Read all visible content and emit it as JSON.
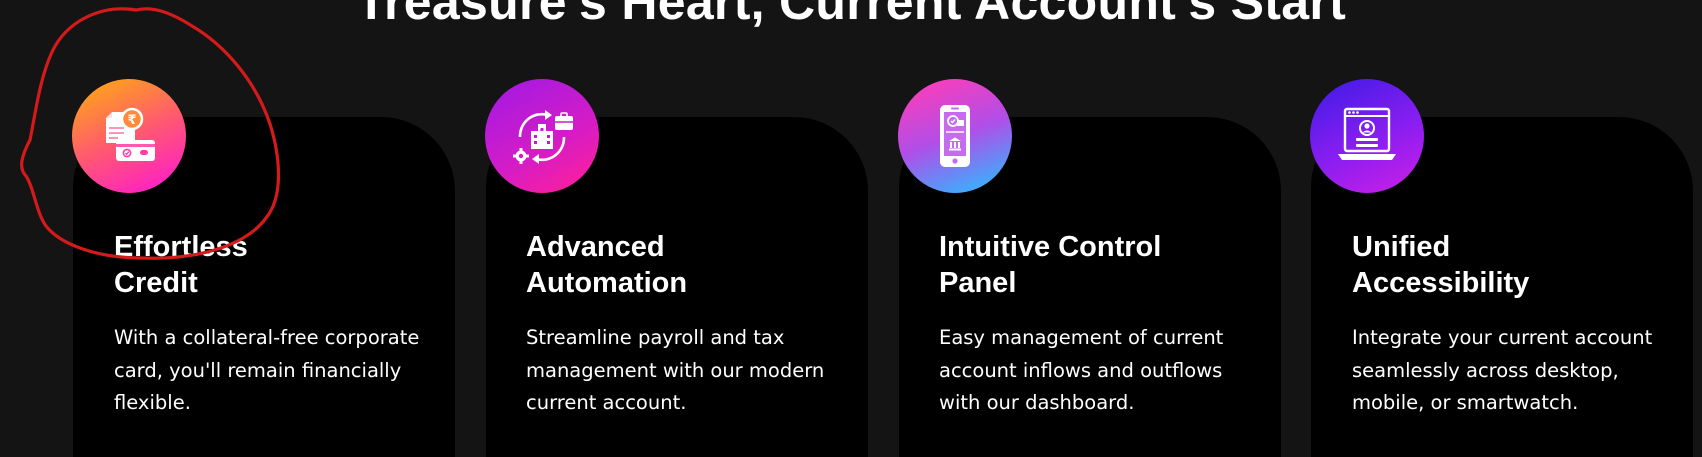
{
  "section": {
    "heading": "Treasure's Heart, Current Account's Start"
  },
  "features": [
    {
      "icon": "credit-card-icon",
      "title_line1": "Effortless",
      "title_line2": "Credit",
      "description": "With a collateral-free corporate card, you'll remain financially flexible."
    },
    {
      "icon": "automation-icon",
      "title_line1": "Advanced",
      "title_line2": "Automation",
      "description": "Streamline payroll and tax management with our modern current account."
    },
    {
      "icon": "mobile-banking-icon",
      "title_line1": "Intuitive Control",
      "title_line2": "Panel",
      "description": "Easy management of current account inflows and outflows with our dashboard."
    },
    {
      "icon": "laptop-profile-icon",
      "title_line1": "Unified",
      "title_line2": "Accessibility",
      "description": "Integrate your current account seamlessly across desktop, mobile, or smartwatch."
    }
  ],
  "colors": {
    "background": "#141414",
    "card": "#000000",
    "annotation": "#d41a1a",
    "icon1": [
      "#ffa31a",
      "#ff1fc8"
    ],
    "icon2": [
      "#c21cd9",
      "#ff1f9a"
    ],
    "icon3": [
      "#ff3db8",
      "#7a5cff",
      "#2fb9ff"
    ],
    "icon4": [
      "#5b1cf0",
      "#c01ff0"
    ]
  }
}
